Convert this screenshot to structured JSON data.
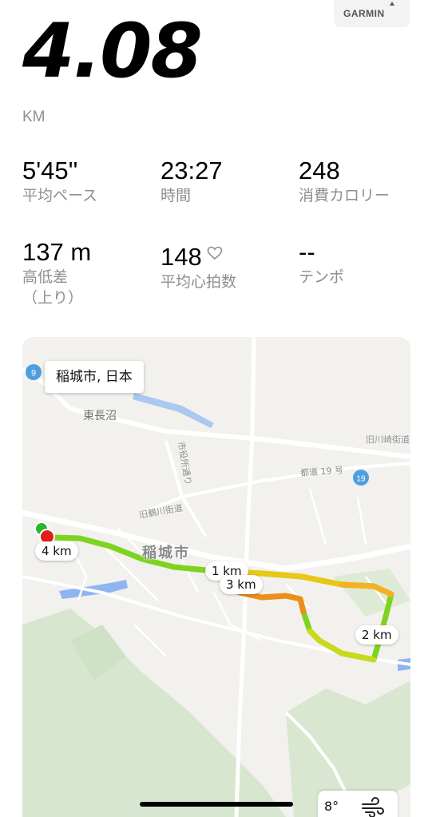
{
  "summary": {
    "distance": "4.08",
    "unit": "KM"
  },
  "brand": {
    "name": "GARMIN"
  },
  "stats": [
    {
      "value": "5'45''",
      "label": "平均ペース"
    },
    {
      "value": "23:27",
      "label": "時間"
    },
    {
      "value": "248",
      "label": "消費カロリー"
    },
    {
      "value": "137 m",
      "label": "高低差\n（上り）"
    },
    {
      "value": "148",
      "label": "平均心拍数",
      "icon": "heart-outline-icon"
    },
    {
      "value": "--",
      "label": "テンポ"
    }
  ],
  "map": {
    "location": "稲城市, 日本",
    "km_markers": [
      "1 km",
      "2 km",
      "3 km",
      "4 km"
    ],
    "places": {
      "district": "東長沼",
      "city": "稲城市",
      "road_kawasaki": "旧川崎街道",
      "road_tsurukawa": "旧鶴川街道",
      "road_shiyakusho": "市役所通り",
      "road_todo": "都道 19 号",
      "shield_9": "9",
      "shield_19": "19"
    },
    "route_colors": {
      "start": "#2db52d",
      "end": "#e01e1e",
      "fast": "#7ed321",
      "mid": "#d4e022",
      "slow": "#f5a623"
    },
    "weather": {
      "temp": "8°",
      "icon": "wind-icon"
    }
  }
}
